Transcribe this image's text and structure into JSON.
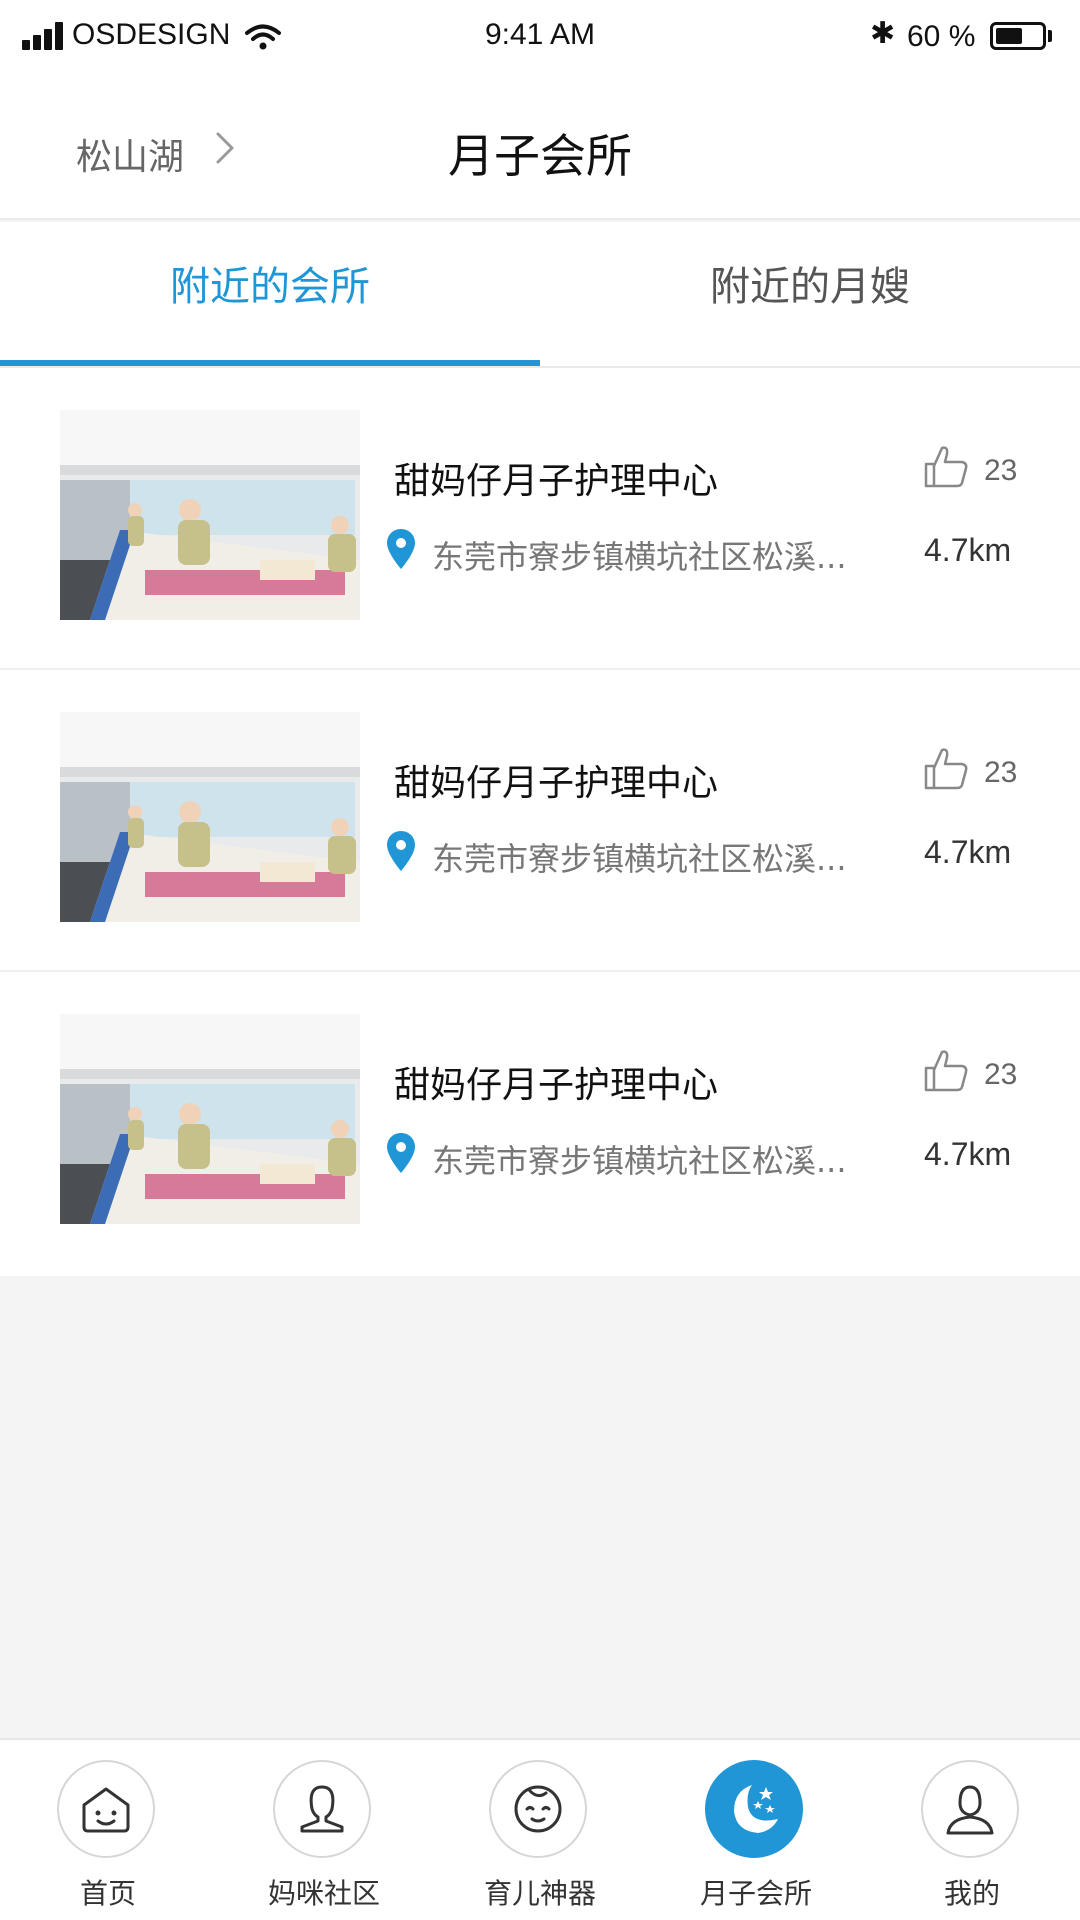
{
  "status_bar": {
    "carrier": "OSDESIGN",
    "time": "9:41 AM",
    "battery": "60 %",
    "battery_level": 0.6
  },
  "nav": {
    "location": "松山湖",
    "title": "月子会所"
  },
  "tabs": [
    {
      "label": "附近的会所",
      "active": true
    },
    {
      "label": "附近的月嫂",
      "active": false
    }
  ],
  "accent_color": "#2196d6",
  "list": [
    {
      "name": "甜妈仔月子护理中心",
      "likes": "23",
      "address": "东莞市寮步镇横坑社区松溪...",
      "distance": "4.7km"
    },
    {
      "name": "甜妈仔月子护理中心",
      "likes": "23",
      "address": "东莞市寮步镇横坑社区松溪...",
      "distance": "4.7km"
    },
    {
      "name": "甜妈仔月子护理中心",
      "likes": "23",
      "address": "东莞市寮步镇横坑社区松溪...",
      "distance": "4.7km"
    }
  ],
  "tab_bar": [
    {
      "label": "首页",
      "icon": "home-face-icon",
      "active": false
    },
    {
      "label": "妈咪社区",
      "icon": "mom-person-icon",
      "active": false
    },
    {
      "label": "育儿神器",
      "icon": "baby-face-icon",
      "active": false
    },
    {
      "label": "月子会所",
      "icon": "moon-stars-icon",
      "active": true
    },
    {
      "label": "我的",
      "icon": "user-icon",
      "active": false
    }
  ]
}
